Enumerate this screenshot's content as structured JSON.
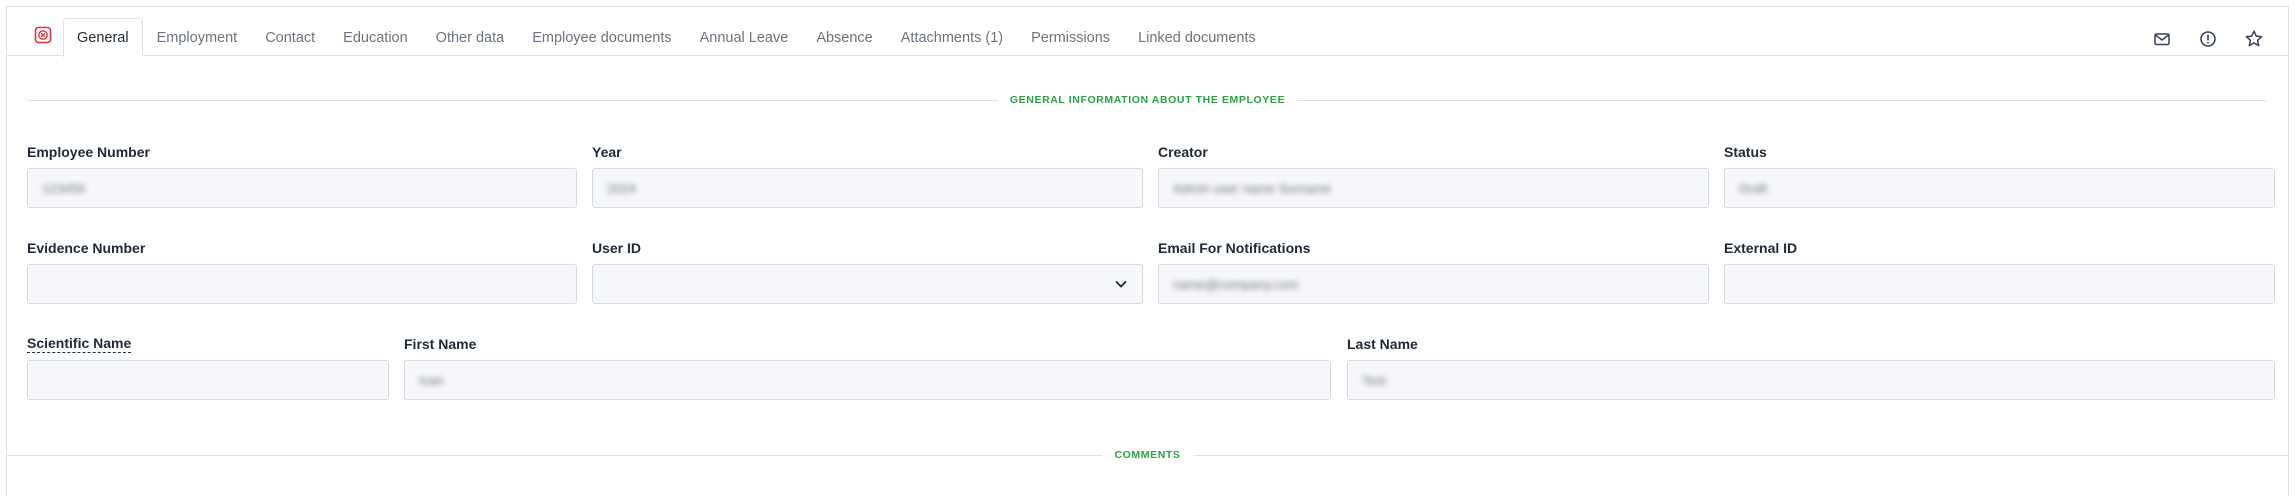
{
  "tabs": [
    {
      "label": "General",
      "active": true
    },
    {
      "label": "Employment"
    },
    {
      "label": "Contact"
    },
    {
      "label": "Education"
    },
    {
      "label": "Other data"
    },
    {
      "label": "Employee documents"
    },
    {
      "label": "Annual Leave"
    },
    {
      "label": "Absence"
    },
    {
      "label": "Attachments (1)"
    },
    {
      "label": "Permissions"
    },
    {
      "label": "Linked documents"
    }
  ],
  "toolbar_icons": [
    "mail-icon",
    "info-icon",
    "star-icon"
  ],
  "sections": {
    "general": "GENERAL INFORMATION ABOUT THE EMPLOYEE",
    "comments": "COMMENTS"
  },
  "fields": {
    "employee_number": {
      "label": "Employee Number",
      "value": "123456"
    },
    "year": {
      "label": "Year",
      "value": "2024"
    },
    "creator": {
      "label": "Creator",
      "value": "Admin user name Surname"
    },
    "status": {
      "label": "Status",
      "value": "Draft"
    },
    "evidence_number": {
      "label": "Evidence Number",
      "value": ""
    },
    "user_id": {
      "label": "User ID",
      "value": ""
    },
    "email_notifications": {
      "label": "Email For Notifications",
      "value": "name@company.com"
    },
    "external_id": {
      "label": "External ID",
      "value": ""
    },
    "scientific_name": {
      "label": "Scientific Name",
      "value": ""
    },
    "first_name": {
      "label": "First Name",
      "value": "Ivan"
    },
    "last_name": {
      "label": "Last Name",
      "value": "Test"
    }
  },
  "colors": {
    "accent_green": "#2ea043",
    "close_red": "#d9363e",
    "input_bg": "#f6f7fa",
    "border": "#dde1e6"
  }
}
